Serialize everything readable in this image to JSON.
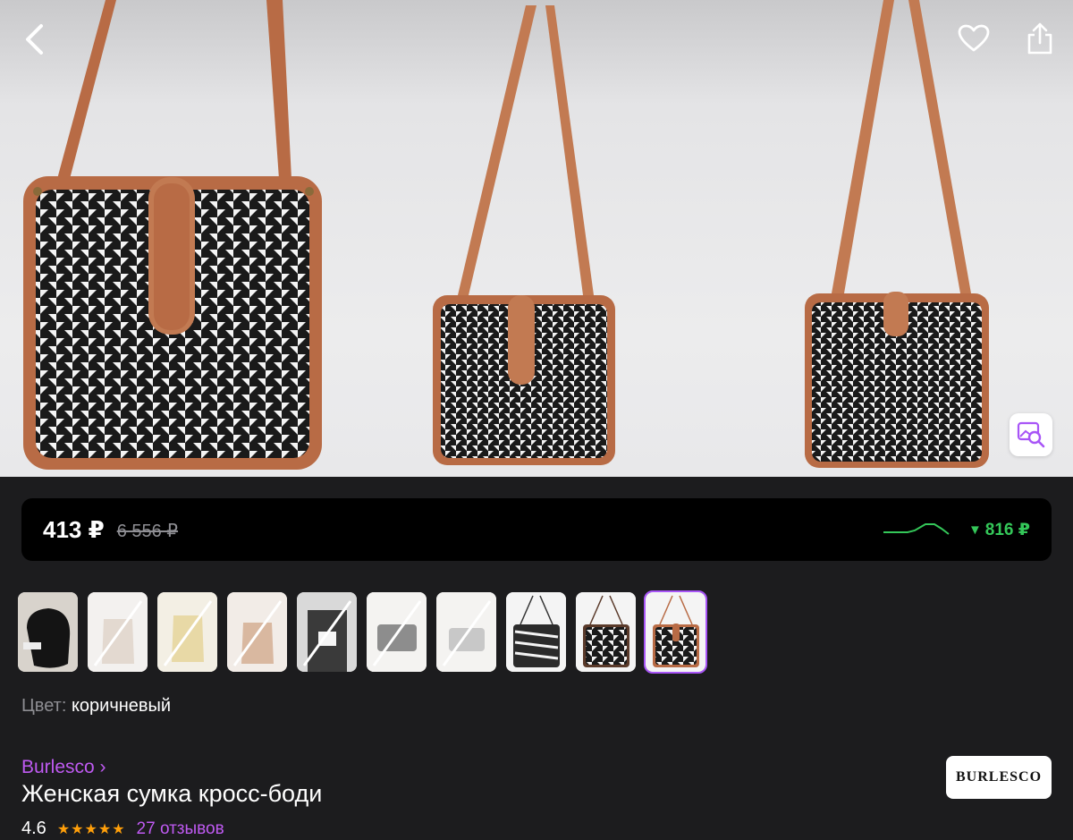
{
  "header": {
    "back_icon": "chevron-left-icon",
    "favorite_icon": "heart-icon",
    "share_icon": "share-icon",
    "image_search_icon": "image-search-icon"
  },
  "price_bar": {
    "price": "413 ₽",
    "old_price": "6 556 ₽",
    "drop": "816 ₽",
    "drop_icon": "triangle-down-icon",
    "accent": "#34c759"
  },
  "thumbnails": {
    "count": 10,
    "selected_index": 9,
    "accent": "#a855f7"
  },
  "color": {
    "label": "Цвет:",
    "value": "коричневый"
  },
  "product": {
    "brand": "Burlesco ›",
    "title": "Женская сумка кросс-боди",
    "rating": "4.6",
    "stars": "★★★★★",
    "reviews": "27 отзывов",
    "brand_logo_text": "BURLESCO",
    "brand_color": "#bf5af2"
  }
}
